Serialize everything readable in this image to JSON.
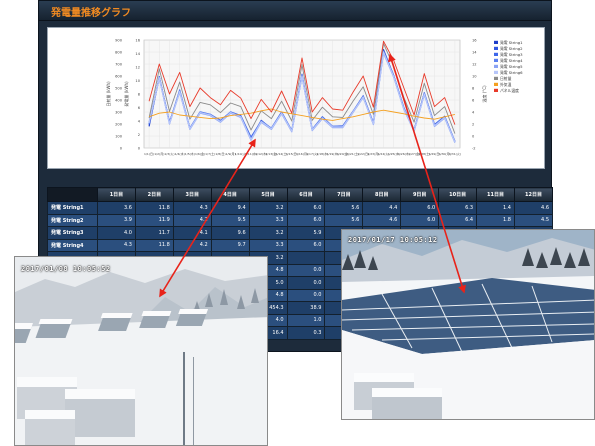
{
  "header": {
    "title": "発電量推移グラフ"
  },
  "chart_data": {
    "type": "line",
    "categories": [
      "1/1",
      "1/2",
      "1/3",
      "1/4",
      "1/5",
      "1/6",
      "1/7",
      "1/8",
      "1/9",
      "1/10",
      "1/11",
      "1/12",
      "1/13",
      "1/14",
      "1/15",
      "1/16",
      "1/17",
      "1/18",
      "1/19",
      "1/20",
      "1/21",
      "1/22",
      "1/23",
      "1/24",
      "1/25",
      "1/26",
      "1/27",
      "1/28",
      "1/29",
      "1/30",
      "1/31"
    ],
    "tick_labels": [
      "1/1(日)",
      "1/2(月)",
      "1/3(火)",
      "1/4(水)",
      "1/5(木)",
      "1/6(金)",
      "1/7(土)",
      "1/8(日)",
      "1/9(月)",
      "1/10(火)",
      "1/11(水)",
      "1/12(木)",
      "1/13(金)",
      "1/14(土)",
      "1/15(日)",
      "1/16(月)",
      "1/17(火)",
      "1/18(水)",
      "1/19(木)",
      "1/20(金)",
      "1/21(土)",
      "1/22(日)",
      "1/23(月)",
      "1/24(火)",
      "1/25(水)",
      "1/26(木)",
      "1/27(金)",
      "1/28(土)",
      "1/29(日)",
      "1/30(月)",
      "1/31(火)"
    ],
    "y_left": {
      "label": "日射量 (kWh)",
      "ticks": [
        "900",
        "800",
        "700",
        "600",
        "500",
        "400",
        "300",
        "200",
        "100",
        "0"
      ],
      "lim": [
        0,
        900
      ]
    },
    "y_mid": {
      "label": "発電量 (kWh)",
      "ticks": [
        "16",
        "14",
        "12",
        "10",
        "8",
        "6",
        "4",
        "2",
        "0"
      ],
      "lim": [
        0,
        16
      ]
    },
    "y_right": {
      "label": "温度 (°C)",
      "ticks": [
        "16",
        "14",
        "12",
        "10",
        "8",
        "6",
        "4",
        "2",
        "0",
        "-2"
      ],
      "lim": [
        -2,
        16
      ]
    },
    "grid": true,
    "legend_position": "right",
    "series": [
      {
        "name": "発電 String1",
        "color": "#1f3ec9",
        "values": [
          3.6,
          11.8,
          4.3,
          9.4,
          3.2,
          6.0,
          5.6,
          4.4,
          6.0,
          5.3,
          1.4,
          4.6,
          3.2,
          5.9,
          2.8,
          12.1,
          3.0,
          5.1,
          3.5,
          3.6,
          6.0,
          8.6,
          4.1,
          16.4,
          12.0,
          6.6,
          2.9,
          9.1,
          3.8,
          5.2,
          1.0
        ]
      },
      {
        "name": "発電 String2",
        "color": "#2f55e0",
        "values": [
          3.9,
          11.9,
          4.2,
          9.5,
          3.3,
          6.0,
          5.6,
          4.6,
          6.0,
          5.4,
          1.8,
          4.5,
          3.3,
          6.0,
          2.9,
          12.3,
          3.1,
          5.2,
          3.6,
          3.7,
          6.1,
          8.7,
          4.2,
          16.2,
          12.1,
          6.7,
          3.0,
          9.2,
          3.9,
          5.3,
          1.1
        ]
      },
      {
        "name": "発電 String3",
        "color": "#3d66ea",
        "values": [
          4.0,
          11.7,
          4.1,
          9.6,
          3.2,
          5.9,
          5.5,
          4.5,
          5.9,
          5.2,
          1.5,
          4.4,
          3.2,
          5.8,
          2.8,
          12.0,
          3.0,
          5.0,
          3.5,
          3.5,
          6.0,
          8.5,
          4.0,
          16.0,
          11.9,
          6.5,
          2.9,
          9.0,
          3.7,
          5.1,
          1.0
        ]
      },
      {
        "name": "発電 String4",
        "color": "#5b80f0",
        "values": [
          4.3,
          11.8,
          4.2,
          9.7,
          3.3,
          6.0,
          5.6,
          4.5,
          6.0,
          5.3,
          1.6,
          4.5,
          3.3,
          5.9,
          2.9,
          12.2,
          3.1,
          5.1,
          3.6,
          3.6,
          6.1,
          8.6,
          4.1,
          16.1,
          12.0,
          6.6,
          3.0,
          9.1,
          3.8,
          5.2,
          1.1
        ]
      },
      {
        "name": "発電 String5",
        "color": "#8aa3f5",
        "values": [
          4.1,
          11.6,
          4.0,
          9.3,
          3.1,
          5.8,
          5.4,
          4.3,
          5.8,
          5.1,
          1.3,
          4.3,
          3.1,
          5.7,
          2.7,
          11.9,
          2.9,
          4.9,
          3.4,
          3.4,
          5.9,
          8.4,
          3.9,
          15.8,
          11.8,
          6.4,
          2.8,
          8.9,
          3.6,
          5.0,
          0.9
        ]
      },
      {
        "name": "発電 String6",
        "color": "#b7c6fa",
        "values": [
          4.2,
          11.7,
          4.1,
          9.4,
          3.2,
          5.9,
          5.5,
          4.4,
          5.9,
          5.2,
          1.4,
          4.4,
          3.2,
          5.8,
          2.8,
          12.0,
          3.0,
          5.0,
          3.5,
          3.5,
          6.0,
          8.5,
          4.0,
          16.0,
          11.9,
          6.5,
          2.9,
          9.0,
          3.7,
          5.1,
          1.0
        ]
      },
      {
        "name": "日射量",
        "color": "#8a8a8a",
        "values": [
          5.0,
          13.2,
          6.1,
          11.0,
          4.8,
          7.6,
          7.2,
          5.9,
          7.5,
          6.9,
          3.0,
          6.2,
          4.9,
          7.8,
          4.5,
          13.9,
          4.6,
          6.8,
          5.2,
          5.1,
          7.8,
          10.2,
          5.6,
          17.4,
          13.6,
          8.4,
          4.3,
          10.8,
          5.4,
          6.9,
          2.4
        ]
      },
      {
        "name": "外気温",
        "color": "#f4a020",
        "values": [
          5.2,
          5.8,
          6.0,
          5.5,
          5.3,
          5.1,
          4.9,
          5.0,
          5.4,
          5.6,
          5.8,
          6.2,
          6.5,
          6.0,
          5.7,
          5.4,
          5.1,
          4.8,
          4.6,
          4.9,
          5.2,
          5.6,
          6.0,
          6.3,
          6.0,
          5.7,
          5.3,
          5.0,
          4.8,
          5.2,
          5.6
        ]
      },
      {
        "name": "パネル温度",
        "color": "#e83a2a",
        "values": [
          7.8,
          14.0,
          9.0,
          12.6,
          6.9,
          10.0,
          8.4,
          7.2,
          9.6,
          8.3,
          4.9,
          8.1,
          6.0,
          9.5,
          5.8,
          15.0,
          6.0,
          8.4,
          6.5,
          6.3,
          9.3,
          12.0,
          6.8,
          17.8,
          14.6,
          10.0,
          5.5,
          12.4,
          6.9,
          8.4,
          3.9
        ]
      }
    ]
  },
  "table": {
    "columns": [
      "1日目",
      "2日目",
      "3日目",
      "4日目",
      "5日目",
      "6日目",
      "7日目",
      "8日目",
      "9日目",
      "10日目",
      "11日目",
      "12日目"
    ],
    "rows": [
      {
        "label": "発電 String1",
        "cells": [
          "3.6",
          "11.8",
          "4.3",
          "9.4",
          "3.2",
          "6.0",
          "5.6",
          "4.4",
          "6.0",
          "6.3",
          "1.4",
          "4.6"
        ]
      },
      {
        "label": "発電 String2",
        "cells": [
          "3.9",
          "11.9",
          "4.2",
          "9.5",
          "3.3",
          "6.0",
          "5.6",
          "4.6",
          "6.0",
          "6.4",
          "1.8",
          "4.5"
        ]
      },
      {
        "label": "発電 String3",
        "cells": [
          "4.0",
          "11.7",
          "4.1",
          "9.6",
          "3.2",
          "5.9",
          "5.5",
          "4.5",
          "5.9",
          "6.2",
          "1.5",
          "4.4"
        ]
      },
      {
        "label": "発電 String4",
        "cells": [
          "4.3",
          "11.8",
          "4.2",
          "9.7",
          "3.3",
          "6.0",
          "5.6",
          "4.5",
          "6.0",
          "6.3",
          "1.6",
          "4.5"
        ]
      },
      {
        "label": "",
        "cells": [
          "",
          "",
          "",
          "",
          "3.2",
          "",
          "",
          "",
          "",
          "",
          "",
          ""
        ]
      },
      {
        "label": "",
        "cells": [
          "",
          "",
          "",
          "",
          "4.8",
          "0.0",
          "",
          "",
          "",
          "",
          "",
          ""
        ]
      },
      {
        "label": "",
        "cells": [
          "",
          "",
          "",
          "",
          "5.0",
          "0.0",
          "",
          "",
          "",
          "",
          "",
          ""
        ]
      },
      {
        "label": "",
        "cells": [
          "",
          "",
          "",
          "",
          "4.8",
          "0.0",
          "",
          "",
          "",
          "",
          "",
          ""
        ]
      },
      {
        "label": "",
        "cells": [
          "",
          "",
          "",
          "",
          "454.3",
          "38.9",
          "",
          "",
          "",
          "",
          "",
          ""
        ]
      },
      {
        "label": "",
        "cells": [
          "",
          "",
          "",
          "",
          "4.0",
          "1.0",
          "",
          "",
          "",
          "",
          "",
          ""
        ]
      },
      {
        "label": "",
        "cells": [
          "",
          "",
          "",
          "",
          "16.4",
          "0.3",
          "",
          "",
          "",
          "",
          "",
          ""
        ]
      }
    ]
  },
  "photos": [
    {
      "timestamp": "2017/01/08  10:05:52"
    },
    {
      "timestamp": "2017/01/17  10:05:12"
    }
  ],
  "colors": {
    "panel_bg": "#1d2b3b",
    "title": "#f28b22",
    "arrow": "#e8231a"
  }
}
